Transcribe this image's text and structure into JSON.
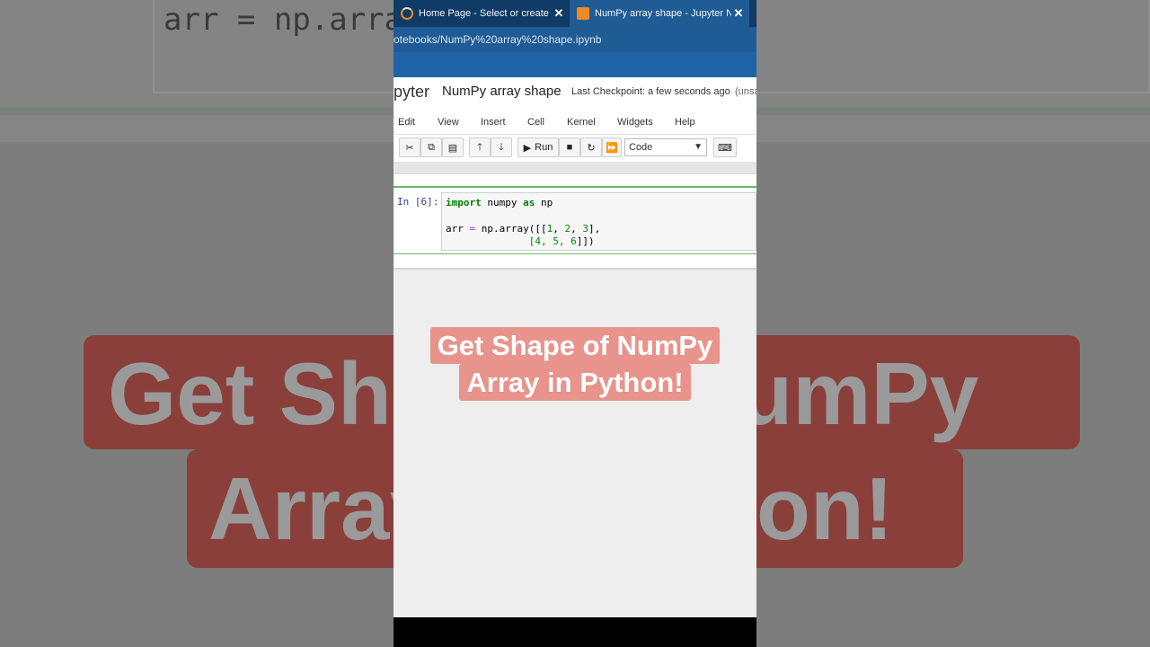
{
  "background": {
    "code_text": "arr = np.array",
    "banner_line1": "Get Shape of NumPy",
    "banner_line2": "Array in Python!"
  },
  "browser": {
    "tabs": [
      {
        "label": "Home Page - Select or create a n",
        "icon": "loading-spinner-icon",
        "close": "✕"
      },
      {
        "label": "NumPy array shape - Jupyter No",
        "icon": "jupyter-notebook-icon",
        "close": "✕"
      }
    ],
    "url": "otebooks/NumPy%20array%20shape.ipynb"
  },
  "jupyter": {
    "logo": "pyter",
    "notebook_title": "NumPy array shape",
    "checkpoint": "Last Checkpoint: a few seconds ago",
    "save_status": "(unsa",
    "menu": [
      "Edit",
      "View",
      "Insert",
      "Cell",
      "Kernel",
      "Widgets",
      "Help"
    ],
    "toolbar": {
      "run_label": "Run",
      "cell_type": "Code"
    },
    "cell": {
      "prompt": "In [6]:",
      "lines": {
        "line1": {
          "kw1": "import",
          "t1": " numpy ",
          "kw2": "as",
          "t2": " np"
        },
        "line3": {
          "t1": "arr ",
          "op": "=",
          "t2": " np.array([[",
          "n1": "1",
          "c1": ", ",
          "n2": "2",
          "c2": ", ",
          "n3": "3",
          "t3": "],"
        },
        "line4": {
          "pad": "              [",
          "n1": "4",
          "c1": ", ",
          "n2": "5",
          "c2": ", ",
          "n3": "6",
          "t3": "]])"
        }
      }
    }
  },
  "overlay": {
    "line1": "Get Shape of NumPy",
    "line2": "Array in Python!",
    "color": "#e8938b"
  }
}
